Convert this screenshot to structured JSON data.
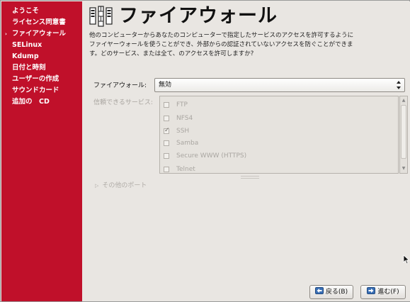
{
  "sidebar": {
    "items": [
      {
        "label": "ようこそ",
        "current": false
      },
      {
        "label": "ライセンス同意書",
        "current": false
      },
      {
        "label": "ファイアウォール",
        "current": true
      },
      {
        "label": "SELinux",
        "current": false
      },
      {
        "label": "Kdump",
        "current": false
      },
      {
        "label": "日付と時刻",
        "current": false
      },
      {
        "label": "ユーザーの作成",
        "current": false
      },
      {
        "label": "サウンドカード",
        "current": false
      },
      {
        "label": "追加の　CD",
        "current": false
      }
    ],
    "current_marker": "›"
  },
  "header": {
    "title": "ファイアウォール",
    "icon": "firewall-icon"
  },
  "description": "他のコンピューターからあなたのコンピューターで指定したサービスのアクセスを許可するようにファイヤーウォールを使うことができ、外部からの認証されていないアクセスを防ぐことができます。どのサービス、または全て、のアクセスを許可しますか?",
  "firewall": {
    "label": "ファイアウォール:",
    "value": "無効"
  },
  "services": {
    "label": "信頼できるサービス:",
    "items": [
      {
        "name": "FTP",
        "checked": false
      },
      {
        "name": "NFS4",
        "checked": false
      },
      {
        "name": "SSH",
        "checked": true
      },
      {
        "name": "Samba",
        "checked": false
      },
      {
        "name": "Secure WWW (HTTPS)",
        "checked": false
      },
      {
        "name": "Telnet",
        "checked": false
      }
    ]
  },
  "other_ports": {
    "label": "その他のポート"
  },
  "buttons": {
    "back": "戻る(B)",
    "next": "進む(F)"
  },
  "colors": {
    "sidebar_bg": "#c0102a",
    "main_bg": "#e9e6e2",
    "disabled_text": "#a9a6a1"
  }
}
